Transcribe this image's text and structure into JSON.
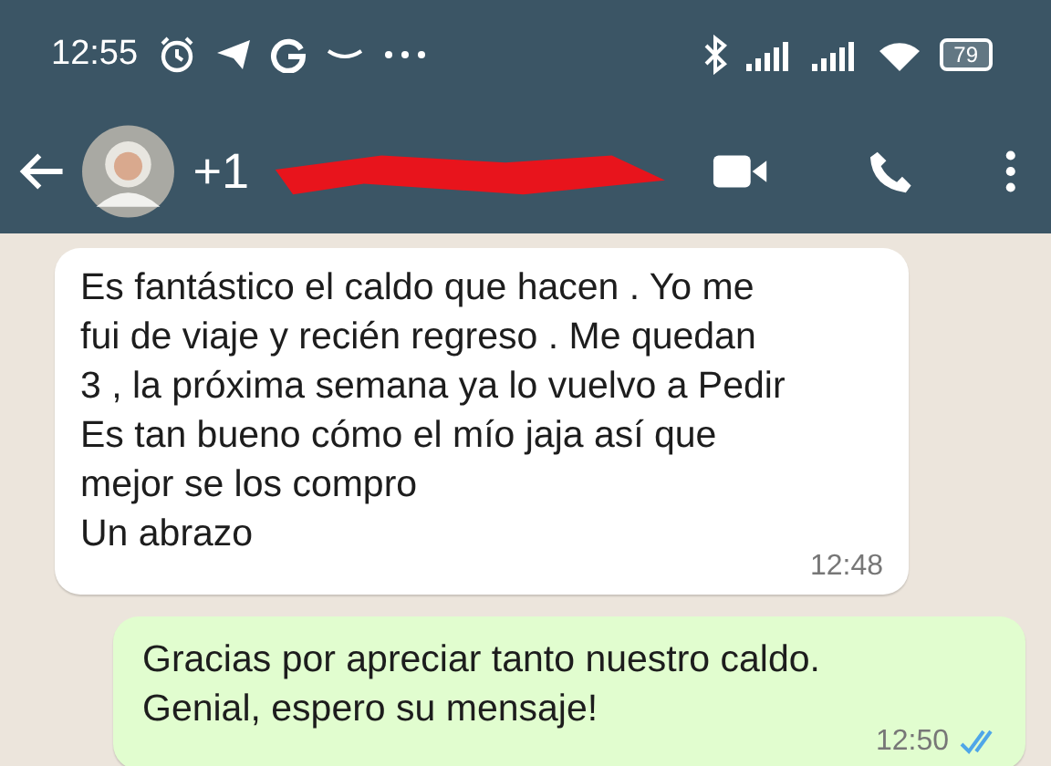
{
  "status_bar": {
    "time": "12:55",
    "battery": "79"
  },
  "header": {
    "contact": "+1",
    "redacted": true
  },
  "messages": [
    {
      "kind": "incoming",
      "text": "Es fantástico el caldo que hacen . Yo me\nfui de viaje y recién regreso . Me quedan\n3 , la próxima semana ya lo vuelvo a Pedir\nEs tan bueno cómo el mío jaja así que\nmejor se los compro\nUn abrazo",
      "time": "12:48"
    },
    {
      "kind": "outgoing",
      "text": "Gracias por apreciar tanto nuestro caldo.\nGenial, espero su mensaje!",
      "time": "12:50",
      "read": true
    }
  ]
}
